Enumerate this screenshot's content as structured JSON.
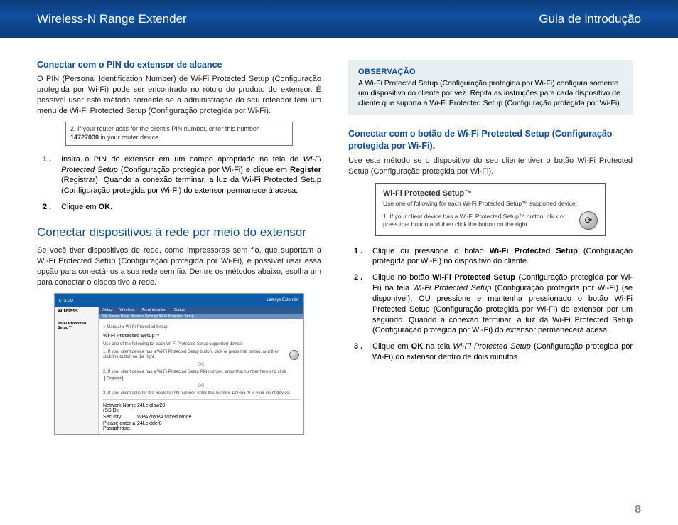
{
  "header": {
    "left": "Wireless-N Range Extender",
    "right": "Guia de introdução"
  },
  "left": {
    "h_pin": "Conectar com o PIN do extensor de alcance",
    "p_pin": "O PIN (Personal Identification Number) de Wi-Fi Protected Setup (Configuração protegida por Wi-Fi) pode ser encontrado no rótulo do produto do extensor. É possível usar este método somente se a administração do seu roteador tem um menu de Wi-Fi Protected Setup (Configuração protegida por Wi-Fi).",
    "pinbox_prefix": "2. If your router asks for the client's PIN number, enter this number ",
    "pinbox_pin": "14727030",
    "pinbox_suffix": " in your router device.",
    "step1_num": "1 .",
    "step1_a": "Insira o PIN do extensor em um campo apropriado na tela de ",
    "step1_b_ital": "Wi-Fi Protected Setup",
    "step1_c": " (Configuração protegida por Wi-Fi) e clique em ",
    "step1_d_bold": "Register",
    "step1_e": " (Registrar). Quando a conexão terminar, a luz da Wi-Fi Protected Setup (Configuração protegida por Wi-Fi) do extensor permanecerá acesa.",
    "step2_num": "2 .",
    "step2_a": "Clique em ",
    "step2_b_bold": "OK",
    "step2_c": ".",
    "h_sec": "Conectar dispositivos à rede por meio do extensor",
    "p_sec": "Se você tiver dispositivos de rede, como impressoras sem fio, que suportam a Wi-Fi Protected Setup (Configuração protegida por Wi-Fi), é possível usar essa opção para conectá-los a sua rede sem fio. Dentre os métodos abaixo, esolha um para conectar o dispositivo à rede.",
    "shot": {
      "brand": "cisco",
      "title_right": "Linksys Extender",
      "side": "Wireless",
      "side_tab": "Wi-Fi Protected Setup™",
      "tabs": [
        "Setup",
        "Wireless",
        "Administration",
        "Status"
      ],
      "subtabs": "Site Survey     Basic Wireless Settings     Wi-Fi Protected Setup",
      "mode": "○ Manual   ● Wi-Fi Protected Setup",
      "wps_t": "Wi-Fi Protected Setup™",
      "wps_sub": "Use one of the following for each Wi-Fi Protected Setup supported device:",
      "opt1": "1. If your client device has a Wi-Fi Protected Setup button, click or press that button, and then click the button on the right.",
      "opt2": "2. If your client device has a Wi-Fi Protected Setup PIN number, enter that number here and click",
      "reg": "Register",
      "opt3": "3. If your client asks for the Router's PIN number, enter this number 12345670 in your client device.",
      "rows": [
        {
          "lab": "Network Name (SSID):",
          "val": "24Lextlow20"
        },
        {
          "lab": "Security:",
          "val": "WPA2/WPA Mixed Mode"
        },
        {
          "lab": "Please enter a Passphrase:",
          "val": "24Lextdef8"
        }
      ]
    }
  },
  "right": {
    "note_title": "OBSERVAÇÃO",
    "note_body": "A Wi-Fi Protected Setup (Configuração protegida por Wi-Fi) configura somente um dispositivo do cliente por vez. Repita as instruções para cada dispositivo de cliente que suporta a Wi-Fi Protected Setup (Configuração protegida por Wi-Fi).",
    "h_btn": "Conectar com o botão de Wi-Fi Protected Setup (Configuração protegida por Wi-Fi).",
    "p_btn": "Use este método se o dispositivo do seu cliente tiver o botão Wi-Fi Protected Setup (Configuração protegida por Wi-Fi).",
    "wps": {
      "title": "Wi-Fi Protected Setup™",
      "sub": "Use one of following for each Wi-Fi Protected Setup™ supported device:",
      "txt": "1. If your client device has a Wi-Fi Protected Setup™ button, click or press that button and then click the button on the right."
    },
    "s1_num": "1 .",
    "s1_a": "Clique ou pressione o botão ",
    "s1_b_bold": "Wi-Fi Protected Setup",
    "s1_c": " (Configuração protegida por Wi-Fi) no dispositivo do cliente.",
    "s2_num": "2 .",
    "s2_a": "Clique no botão ",
    "s2_b_bold": "Wi-Fi Protected Setup",
    "s2_c": " (Configuração protegida por Wi-Fi) na tela ",
    "s2_d_ital": "Wi-Fi Protected Setup",
    "s2_e": " (Configuração protegida por Wi-Fi) (se disponível), OU pressione e mantenha pressionado o botão Wi-Fi Protected Setup (Configuração protegida por Wi-Fi) do extensor por um segundo. Quando a conexão terminar, a luz da Wi-Fi Protected Setup (Configuração protegida por Wi-Fi) do extensor permanecerá acesa.",
    "s3_num": "3 .",
    "s3_a": "Clique em ",
    "s3_b_bold": "OK",
    "s3_c": " na tela ",
    "s3_d_ital": "Wi-Fi Protected Setup",
    "s3_e": " (Configuração protegida por Wi-Fi) do extensor dentro de dois minutos."
  },
  "page_num": "8"
}
